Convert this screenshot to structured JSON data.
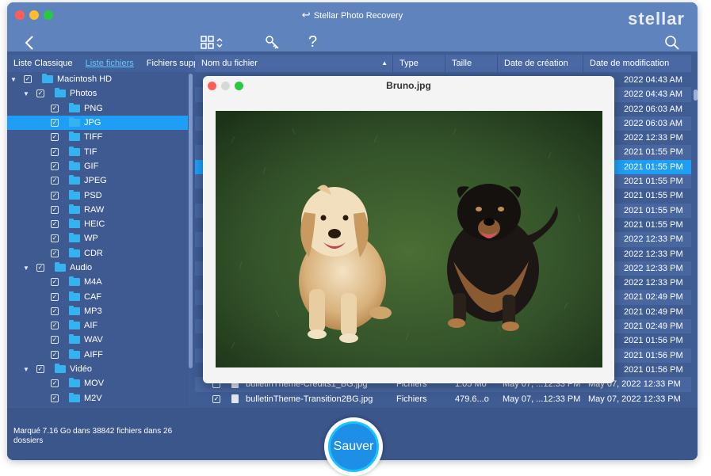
{
  "window": {
    "title": "Stellar Photo Recovery",
    "brand": "stellar"
  },
  "colors": {
    "accent": "#1e9ff5",
    "save_ring": "#18c3ff",
    "folder": "#35b3f0"
  },
  "toolbar": {
    "back_icon": "chevron-left-icon",
    "view_icon": "grid-view-icon",
    "key_icon": "key-icon",
    "help_icon": "help-icon",
    "help_glyph": "?",
    "search_icon": "search-icon"
  },
  "tabs": [
    "Liste Classique",
    "Liste fichiers",
    "Fichiers supp"
  ],
  "columns": [
    "Nom du fichier",
    "Type",
    "Taille",
    "Date de création",
    "Date de modification"
  ],
  "tree": [
    {
      "label": "Macintosh HD",
      "level": 0,
      "expanded": true,
      "checked": true
    },
    {
      "label": "Photos",
      "level": 1,
      "expanded": true,
      "checked": true
    },
    {
      "label": "PNG",
      "level": 2,
      "checked": true
    },
    {
      "label": "JPG",
      "level": 2,
      "checked": true,
      "selected": true
    },
    {
      "label": "TIFF",
      "level": 2,
      "checked": true
    },
    {
      "label": "TIF",
      "level": 2,
      "checked": true
    },
    {
      "label": "GIF",
      "level": 2,
      "checked": true
    },
    {
      "label": "JPEG",
      "level": 2,
      "checked": true
    },
    {
      "label": "PSD",
      "level": 2,
      "checked": true
    },
    {
      "label": "RAW",
      "level": 2,
      "checked": true
    },
    {
      "label": "HEIC",
      "level": 2,
      "checked": true
    },
    {
      "label": "WP",
      "level": 2,
      "checked": true
    },
    {
      "label": "CDR",
      "level": 2,
      "checked": true
    },
    {
      "label": "Audio",
      "level": 1,
      "expanded": true,
      "checked": true
    },
    {
      "label": "M4A",
      "level": 2,
      "checked": true
    },
    {
      "label": "CAF",
      "level": 2,
      "checked": true
    },
    {
      "label": "MP3",
      "level": 2,
      "checked": true
    },
    {
      "label": "AIF",
      "level": 2,
      "checked": true
    },
    {
      "label": "WAV",
      "level": 2,
      "checked": true
    },
    {
      "label": "AIFF",
      "level": 2,
      "checked": true
    },
    {
      "label": "Vidéo",
      "level": 1,
      "expanded": true,
      "checked": true
    },
    {
      "label": "MOV",
      "level": 2,
      "checked": true
    },
    {
      "label": "M2V",
      "level": 2,
      "checked": true
    }
  ],
  "files": [
    {
      "modified": "2022 04:43 AM"
    },
    {
      "modified": "2022 04:43 AM"
    },
    {
      "modified": "2022 06:03 AM"
    },
    {
      "modified": "2022 06:03 AM"
    },
    {
      "modified": "2022 12:33 PM"
    },
    {
      "modified": "2021 01:55 PM"
    },
    {
      "modified": "2021 01:55 PM",
      "selected": true
    },
    {
      "modified": "2021 01:55 PM"
    },
    {
      "modified": "2021 01:55 PM"
    },
    {
      "modified": "2021 01:55 PM"
    },
    {
      "modified": "2021 01:55 PM"
    },
    {
      "modified": "2022 12:33 PM"
    },
    {
      "modified": "2022 12:33 PM"
    },
    {
      "modified": "2022 12:33 PM"
    },
    {
      "modified": "2022 12:33 PM"
    },
    {
      "modified": "2021 02:49 PM"
    },
    {
      "modified": "2021 02:49 PM"
    },
    {
      "modified": "2021 02:49 PM"
    },
    {
      "modified": "2021 01:56 PM"
    },
    {
      "modified": "2021 01:56 PM"
    },
    {
      "modified": "2021 01:56 PM"
    },
    {
      "name": "bulletinTheme-Credits1_BG.jpg",
      "type": "Fichiers",
      "size": "1.05 Mo",
      "created": "May 07, ...12:33 PM",
      "modified": "May 07, 2022 12:33 PM"
    },
    {
      "name": "bulletinTheme-Transition2BG.jpg",
      "type": "Fichiers",
      "size": "479.6...o",
      "created": "May 07, ...12:33 PM",
      "modified": "May 07, 2022 12:33 PM",
      "checked": true
    }
  ],
  "preview": {
    "title": "Bruno.jpg"
  },
  "status": {
    "text": "Marqué 7.16 Go dans 38842 fichiers dans 26 dossiers"
  },
  "save_button": {
    "label": "Sauver"
  }
}
